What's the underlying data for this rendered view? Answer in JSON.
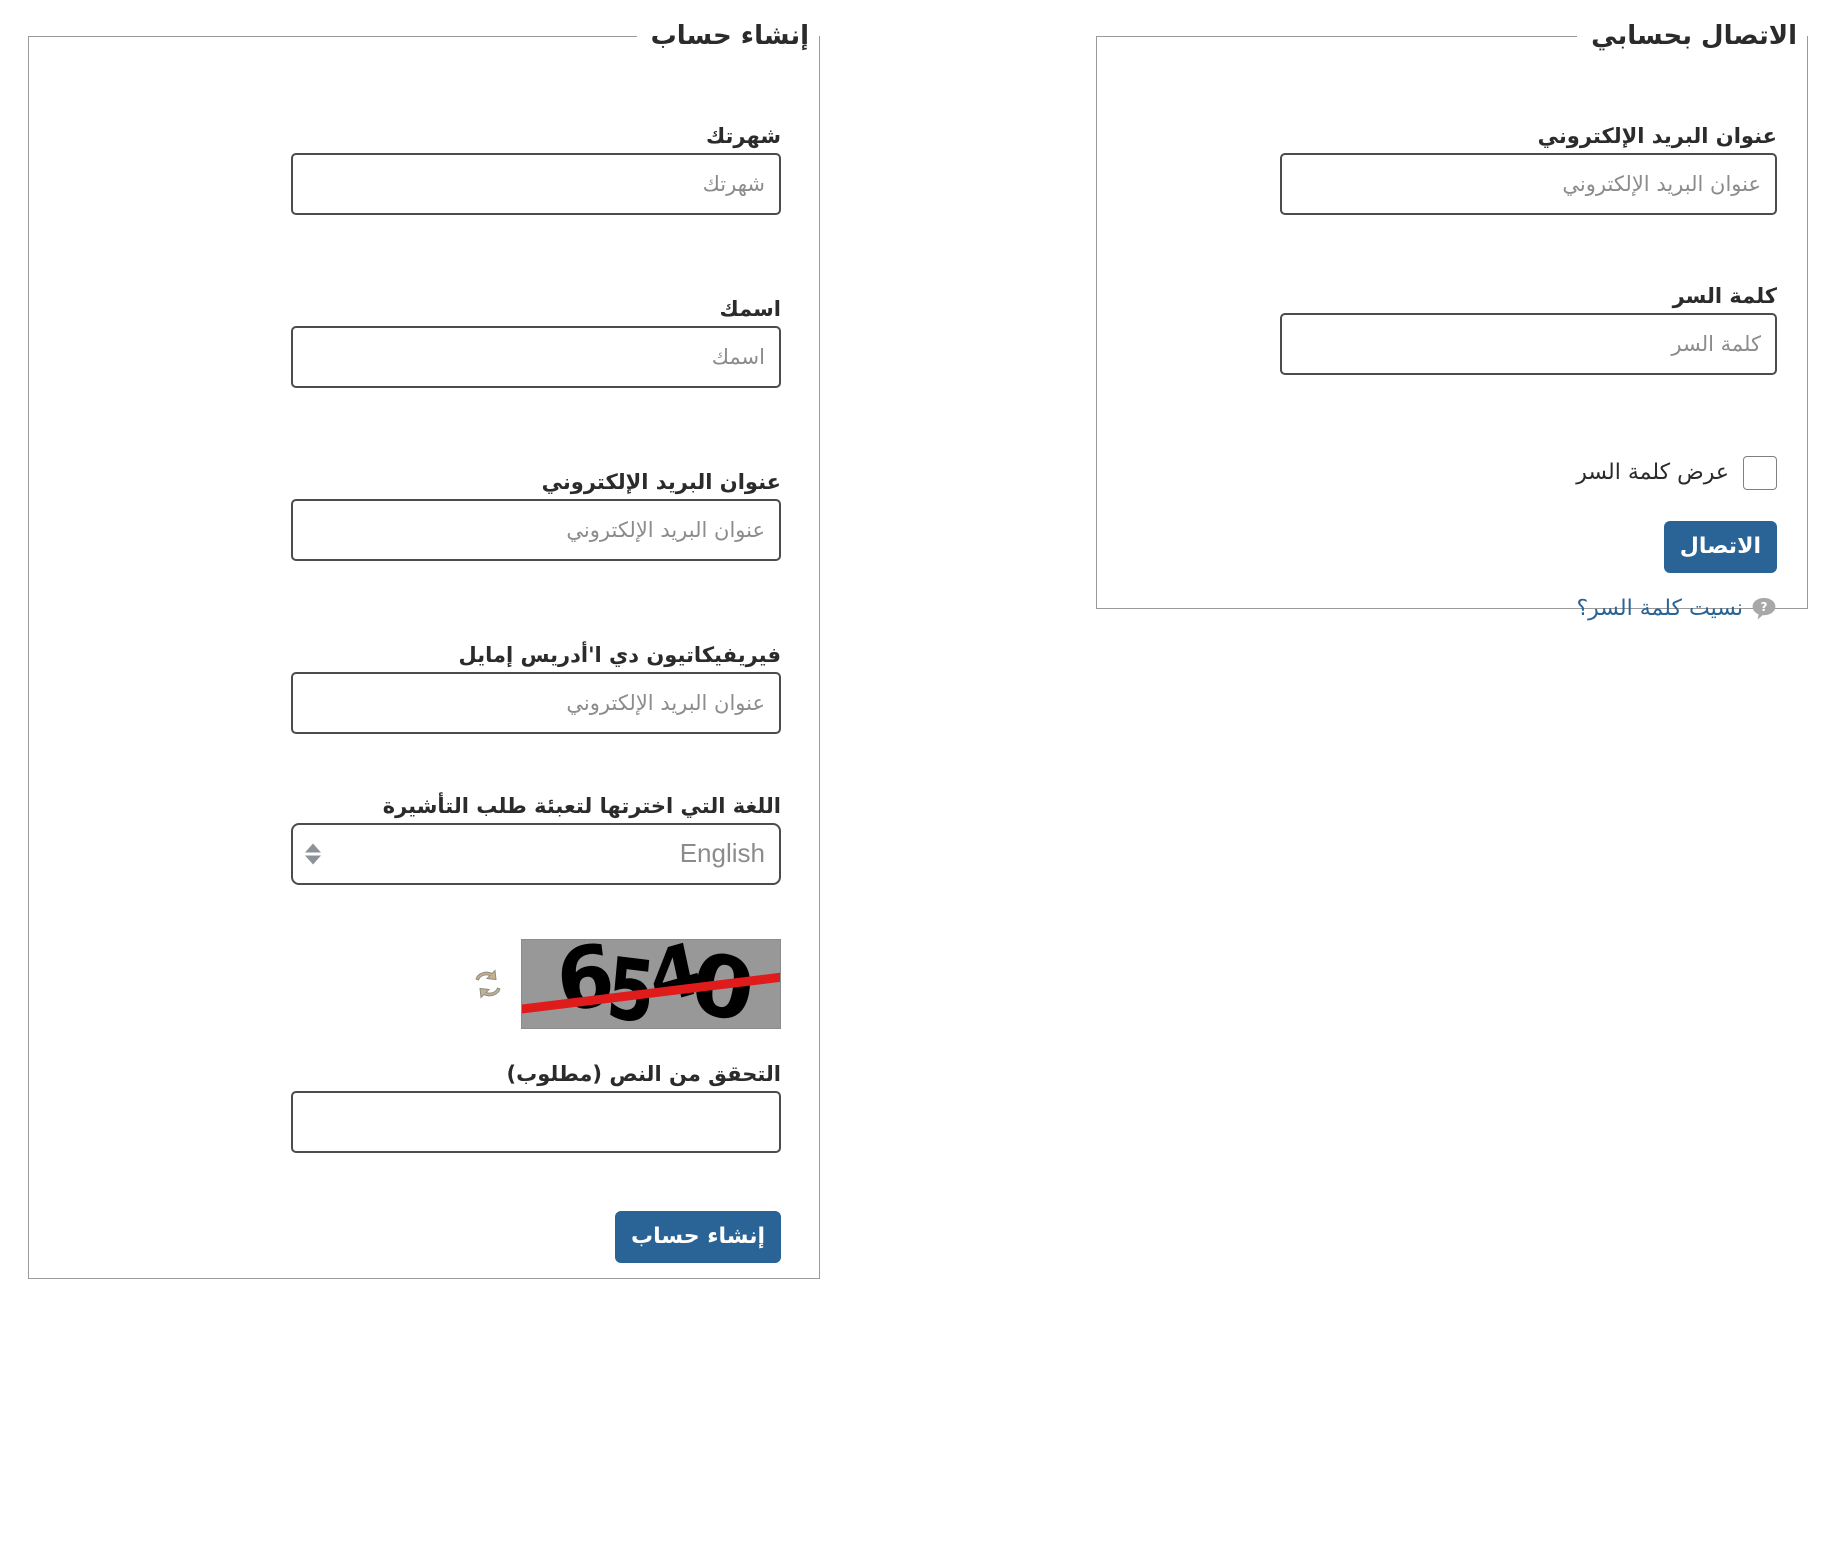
{
  "login_panel": {
    "legend": "الاتصال بحسابي",
    "email": {
      "label": "عنوان البريد الإلكتروني",
      "placeholder": "عنوان البريد الإلكتروني",
      "value": ""
    },
    "password": {
      "label": "كلمة السر",
      "placeholder": "كلمة السر",
      "value": ""
    },
    "show_password": {
      "label": "عرض كلمة السر",
      "checked": false
    },
    "submit_label": "الاتصال",
    "forgot_link": "نسيت كلمة السر؟",
    "help_icon": "help-bubble-icon"
  },
  "register_panel": {
    "legend": "إنشاء حساب",
    "surname": {
      "label": "شهرتك",
      "placeholder": "شهرتك",
      "value": ""
    },
    "firstname": {
      "label": "اسمك",
      "placeholder": "اسمك",
      "value": ""
    },
    "email": {
      "label": "عنوان البريد الإلكتروني",
      "placeholder": "عنوان البريد الإلكتروني",
      "value": ""
    },
    "email_confirm": {
      "label": "فيريفيكاتيون دي ا'أدريس إمايل",
      "placeholder": "عنوان البريد الإلكتروني",
      "value": ""
    },
    "language": {
      "label": "اللغة التي اخترتها لتعبئة طلب التأشيرة",
      "selected": "English",
      "spinner_icon": "updown-spinner-icon"
    },
    "captcha": {
      "text": "6540",
      "refresh_icon": "refresh-icon",
      "image_alt": "captcha-image"
    },
    "captcha_input": {
      "label": "التحقق من النص (مطلوب)",
      "placeholder": "",
      "value": ""
    },
    "submit_label": "إنشاء حساب"
  },
  "colors": {
    "accent": "#2a6496",
    "panel_border": "#9a9a9a",
    "input_border": "#4c4c4c",
    "placeholder": "#8c8c8c",
    "captcha_bg": "#989898",
    "captcha_strike": "#e01b1b"
  }
}
